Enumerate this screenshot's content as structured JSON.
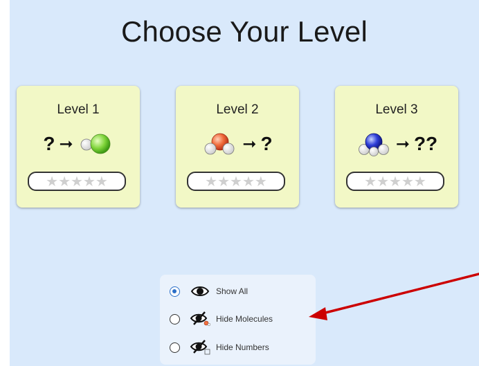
{
  "screen": {
    "title": "Choose Your Level"
  },
  "levels": [
    {
      "label": "Level 1",
      "left_text": "?",
      "right_text": "",
      "stars": "★★★★★",
      "stars_earned": 0
    },
    {
      "label": "Level 2",
      "left_text": "",
      "right_text": "?",
      "stars": "★★★★★",
      "stars_earned": 0
    },
    {
      "label": "Level 3",
      "left_text": "",
      "right_text": "??",
      "stars": "★★★★★",
      "stars_earned": 0
    }
  ],
  "view_options": {
    "selected": "Show All",
    "items": [
      {
        "label": "Show All"
      },
      {
        "label": "Hide Molecules"
      },
      {
        "label": "Hide Numbers"
      }
    ]
  },
  "colors": {
    "background": "#d9e9fb",
    "card": "#f2f8c6",
    "radio_selected": "#2b6fc8",
    "arrow_annotation": "#cc0000"
  }
}
